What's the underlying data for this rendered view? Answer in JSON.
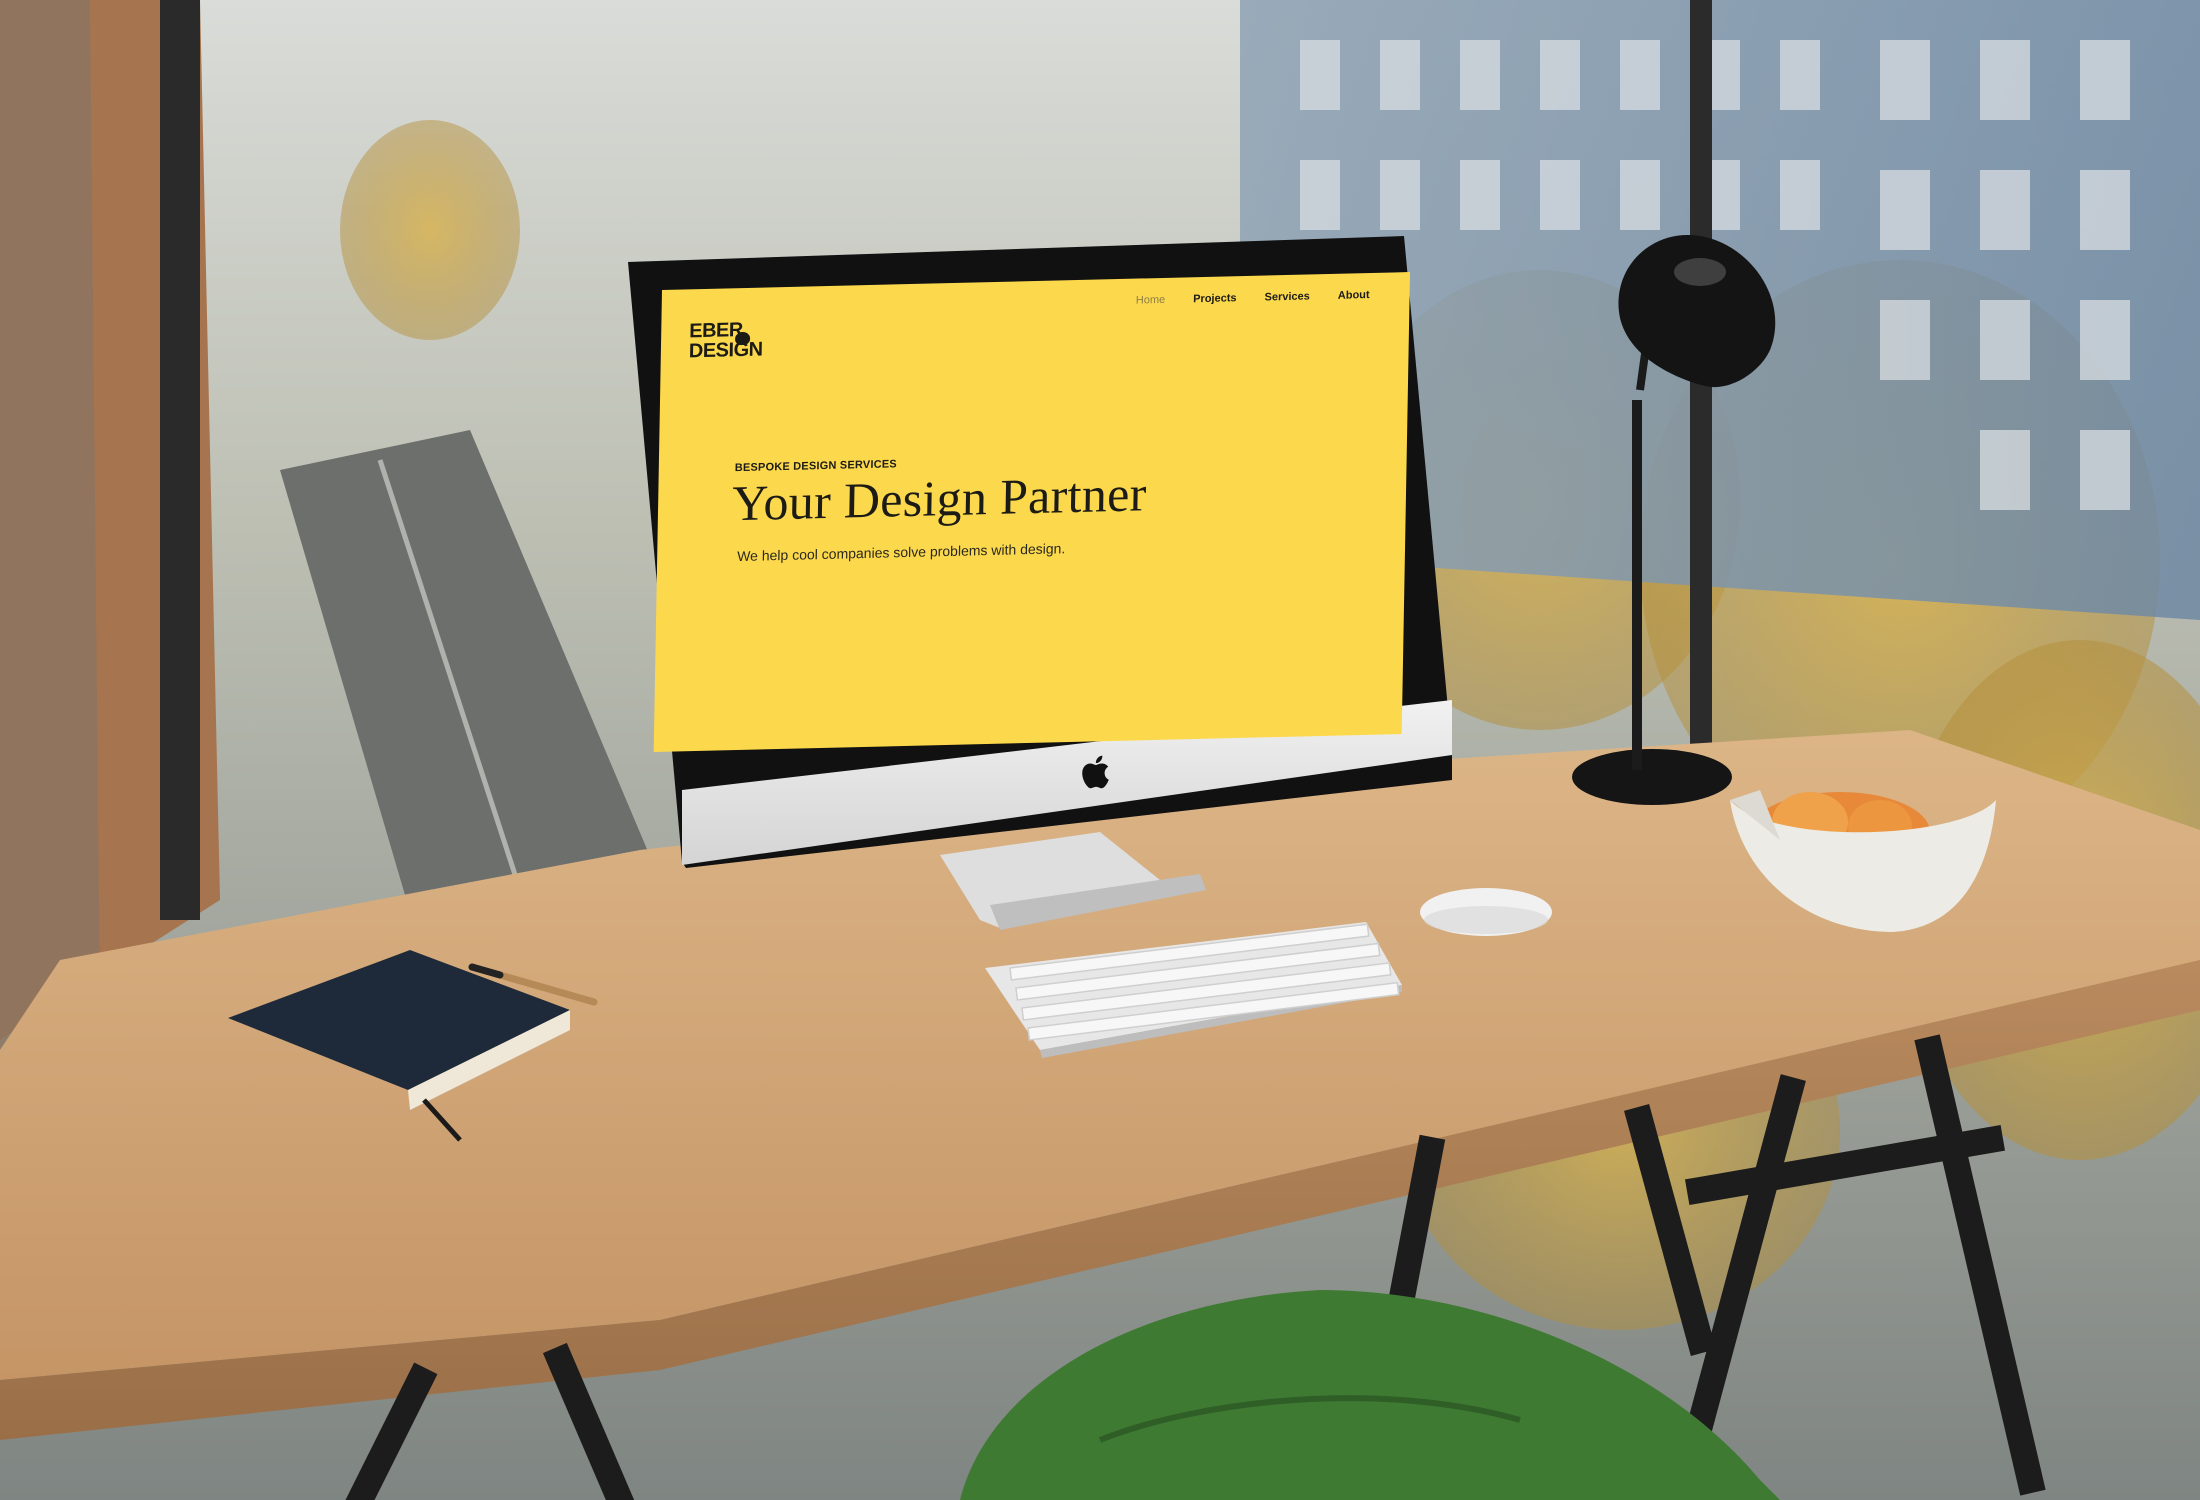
{
  "site": {
    "logo_line1": "EBER",
    "logo_line2": "DESIGN",
    "nav": [
      {
        "label": "Home",
        "active": true
      },
      {
        "label": "Projects",
        "active": false
      },
      {
        "label": "Services",
        "active": false
      },
      {
        "label": "About",
        "active": false
      }
    ],
    "eyebrow": "BESPOKE DESIGN SERVICES",
    "headline": "Your Design Partner",
    "tagline": "We help cool companies solve problems with design."
  },
  "colors": {
    "screen_bg": "#fcd94c",
    "text_dark": "#1c1b16",
    "nav_active": "#8e7e48",
    "desk_wood": "#d7ad7c",
    "cushion_green": "#3f7a33"
  },
  "icons": [
    "apple-logo-icon"
  ]
}
